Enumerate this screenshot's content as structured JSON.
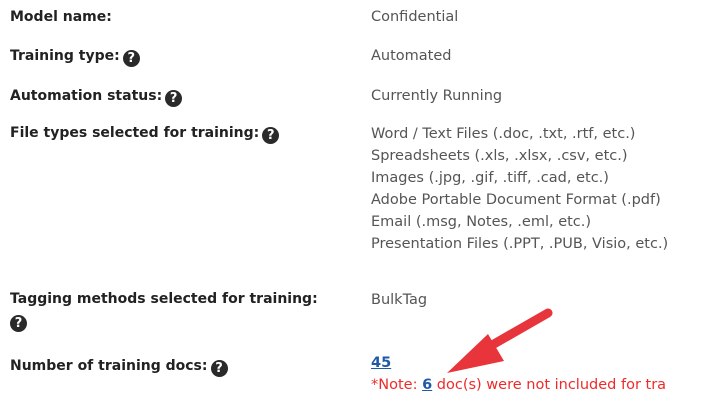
{
  "fields": {
    "model_name": {
      "label": "Model name:",
      "value": "Confidential"
    },
    "training_type": {
      "label": "Training type:",
      "value": "Automated"
    },
    "automation_status": {
      "label": "Automation status:",
      "value": "Currently Running"
    },
    "file_types": {
      "label": "File types selected for training:",
      "values": [
        "Word / Text Files (.doc, .txt, .rtf, etc.)",
        "Spreadsheets (.xls, .xlsx, .csv, etc.)",
        "Images (.jpg, .gif, .tiff, .cad, etc.)",
        "Adobe Portable Document Format (.pdf)",
        "Email (.msg, Notes, .eml, etc.)",
        "Presentation Files (.PPT, .PUB, Visio, etc.)"
      ]
    },
    "tagging_methods": {
      "label": "Tagging methods selected for training:",
      "value": "BulkTag"
    },
    "training_docs": {
      "label": "Number of training docs:",
      "count": "45",
      "note_prefix": "*Note: ",
      "note_count": "6",
      "note_suffix": " doc(s) were not included for tra"
    }
  },
  "icons": {
    "help": "question-circle-icon",
    "annotation": "red-arrow-annotation"
  },
  "colors": {
    "label": "#222222",
    "value": "#555555",
    "link": "#1f5aa6",
    "note": "#ee2a2a",
    "arrow": "#e8353c"
  }
}
